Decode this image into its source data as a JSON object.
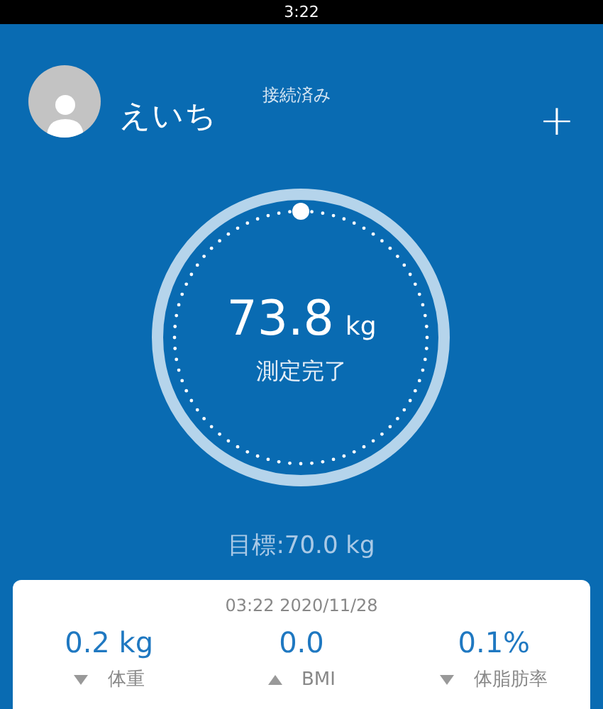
{
  "status_bar": {
    "time": "3:22"
  },
  "header": {
    "user_name": "えいち",
    "connection": "接続済み",
    "add_button": "+"
  },
  "gauge": {
    "value": "73.8",
    "unit": "kg",
    "status": "測定完了"
  },
  "target": "目標:70.0 kg",
  "result_card": {
    "timestamp": "03:22 2020/11/28",
    "metrics": [
      {
        "value": "0.2 kg",
        "label": "体重",
        "kind": "down"
      },
      {
        "value": "0.0",
        "label": "BMI",
        "kind": "up"
      },
      {
        "value": "0.1%",
        "label": "体脂肪率",
        "kind": "down"
      }
    ]
  }
}
